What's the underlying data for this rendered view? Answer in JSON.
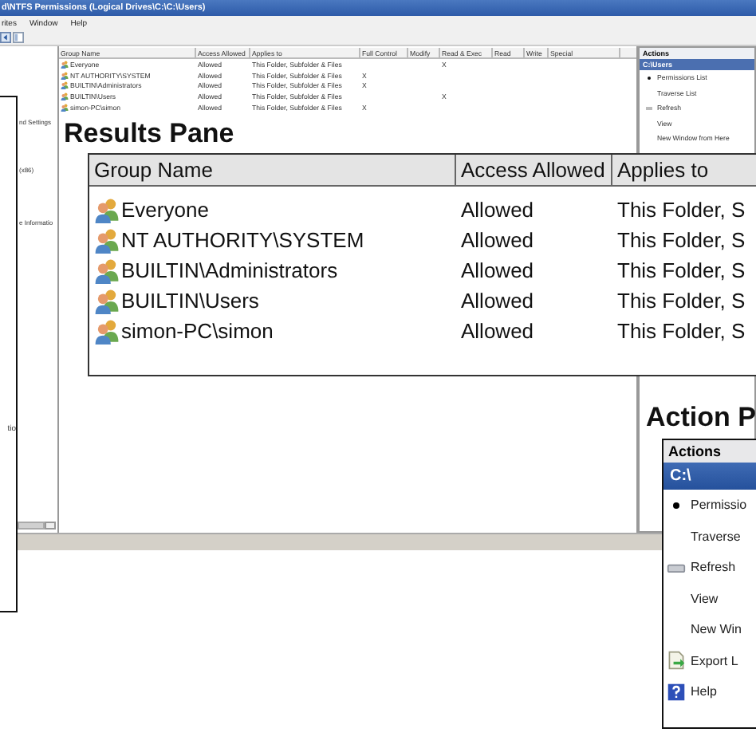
{
  "window": {
    "title": "d\\NTFS Permissions (Logical Drives\\C:\\C:\\Users)",
    "menu": [
      "rites",
      "Window",
      "Help"
    ]
  },
  "tree_pane": {
    "items": [
      "nd Settings",
      "(x86)",
      "e Informatio"
    ]
  },
  "permissions_table": {
    "columns": [
      "Group Name",
      "Access Allowed",
      "Applies to",
      "Full Control",
      "Modify",
      "Read & Exec",
      "Read",
      "Write",
      "Special"
    ],
    "rows": [
      {
        "cells": [
          "Everyone",
          "Allowed",
          "This Folder, Subfolder & Files",
          null,
          null,
          "X",
          null,
          null,
          null
        ]
      },
      {
        "cells": [
          "NT AUTHORITY\\SYSTEM",
          "Allowed",
          "This Folder, Subfolder & Files",
          "X",
          null,
          null,
          null,
          null,
          null
        ]
      },
      {
        "cells": [
          "BUILTIN\\Administrators",
          "Allowed",
          "This Folder, Subfolder & Files",
          "X",
          null,
          null,
          null,
          null,
          null
        ]
      },
      {
        "cells": [
          "BUILTIN\\Users",
          "Allowed",
          "This Folder, Subfolder & Files",
          null,
          null,
          "X",
          null,
          null,
          null
        ]
      },
      {
        "cells": [
          "simon-PC\\simon",
          "Allowed",
          "This Folder, Subfolder & Files",
          "X",
          null,
          null,
          null,
          null,
          null
        ]
      }
    ]
  },
  "actions_pane": {
    "title": "Actions",
    "items": [
      {
        "label": "C:\\Users",
        "kind": "header"
      },
      {
        "label": "Permissions List",
        "kind": "bullet"
      },
      {
        "label": "Traverse List",
        "kind": "plain"
      },
      {
        "label": "Refresh",
        "kind": "refresh"
      },
      {
        "label": "View",
        "kind": "plain"
      },
      {
        "label": "New Window from Here",
        "kind": "plain"
      }
    ]
  },
  "callouts": {
    "scope": {
      "text": "tio"
    },
    "results": {
      "title": "Results Pane",
      "columns": [
        "Group Name",
        "Access Allowed",
        "Applies to"
      ],
      "rows": [
        {
          "name": "Everyone",
          "access": "Allowed",
          "applies_to": "This Folder, S"
        },
        {
          "name": "NT AUTHORITY\\SYSTEM",
          "access": "Allowed",
          "applies_to": "This Folder, S"
        },
        {
          "name": "BUILTIN\\Administrators",
          "access": "Allowed",
          "applies_to": "This Folder, S"
        },
        {
          "name": "BUILTIN\\Users",
          "access": "Allowed",
          "applies_to": "This Folder, S"
        },
        {
          "name": "simon-PC\\simon",
          "access": "Allowed",
          "applies_to": "This Folder, S"
        }
      ]
    },
    "action": {
      "title": "Action P",
      "pane_title": "Actions",
      "items": [
        {
          "label": "C:\\",
          "kind": "header"
        },
        {
          "label": "Permissio",
          "kind": "bullet"
        },
        {
          "label": "Traverse",
          "kind": "plain"
        },
        {
          "label": "Refresh",
          "kind": "refresh"
        },
        {
          "label": "View",
          "kind": "plain"
        },
        {
          "label": "New Win",
          "kind": "plain"
        },
        {
          "label": "Export L",
          "kind": "export"
        },
        {
          "label": "Help",
          "kind": "help"
        }
      ]
    }
  }
}
